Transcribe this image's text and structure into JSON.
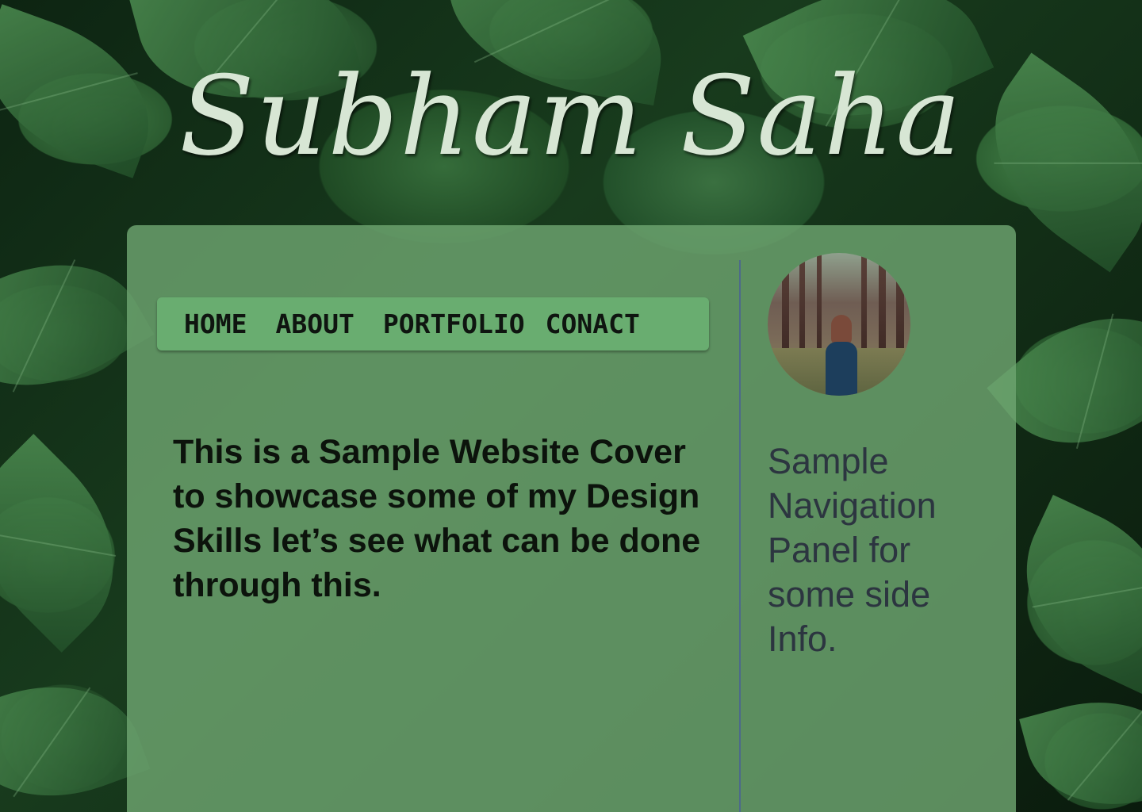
{
  "site": {
    "title": "Subham Saha"
  },
  "nav": {
    "items": [
      {
        "label": "HOME"
      },
      {
        "label": "ABOUT"
      },
      {
        "label": "PORTFOLIO"
      },
      {
        "label": "CONACT"
      }
    ]
  },
  "main": {
    "intro": "This is a Sample Website Cover to showcase some of my Design Skills let’s see what can be done through this."
  },
  "sidebar": {
    "text": "Sample Navigation Panel for some side Info."
  },
  "colors": {
    "card": "#6ea570",
    "nav": "#69ad70",
    "title": "#d7e6d4",
    "divider": "#4d6a8a"
  }
}
